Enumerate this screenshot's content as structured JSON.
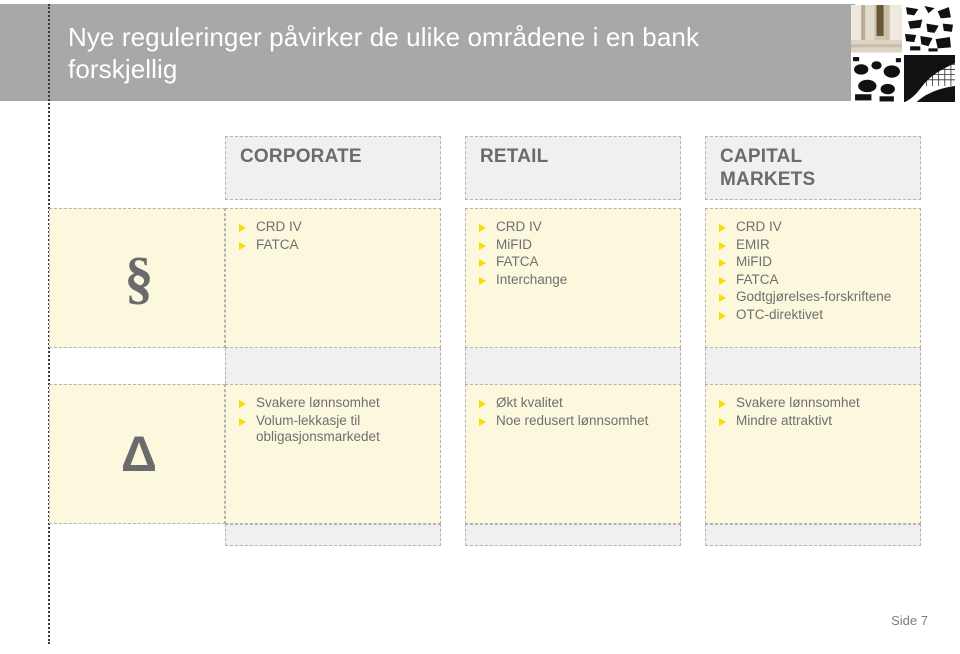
{
  "slide": {
    "title": "Nye reguleringer påvirker de ulike områdene i en bank\nforskjellig",
    "page_label": "Side 7",
    "colors": {
      "header_band": "#a8a8a8",
      "header_text": "#ffffff",
      "cell_cream": "#fbf8dd",
      "cell_grey": "#eef0f1",
      "text_grey": "#6f6f6f",
      "bullet_yellow": "#f4e000",
      "grid_dash": "#b3b3b3"
    }
  },
  "columns": [
    {
      "id": "corporate",
      "title": "CORPORATE"
    },
    {
      "id": "retail",
      "title": "RETAIL"
    },
    {
      "id": "capital_markets",
      "title": "CAPITAL\nMARKETS"
    }
  ],
  "rows": [
    {
      "id": "regulations",
      "glyph": "§",
      "glyph_name": "paragraph-symbol",
      "cells": [
        {
          "column": "corporate",
          "items": [
            "CRD IV",
            "FATCA"
          ]
        },
        {
          "column": "retail",
          "items": [
            "CRD IV",
            "MiFID",
            "FATCA",
            "Interchange"
          ]
        },
        {
          "column": "capital_markets",
          "items": [
            "CRD IV",
            "EMIR",
            "MiFID",
            "FATCA",
            "Godtgjørelses-forskriftene",
            "OTC-direktivet"
          ]
        }
      ]
    },
    {
      "id": "effects",
      "glyph": "Δ",
      "glyph_name": "delta-symbol",
      "cells": [
        {
          "column": "corporate",
          "items": [
            "Svakere lønnsomhet",
            "Volum-lekkasje til obligasjonsmarkedet"
          ]
        },
        {
          "column": "retail",
          "items": [
            "Økt kvalitet",
            "Noe redusert lønnsomhet"
          ]
        },
        {
          "column": "capital_markets",
          "items": [
            "Svakere lønnsomhet",
            "Mindre attraktivt"
          ]
        }
      ]
    },
    {
      "id": "empty",
      "glyph": "",
      "glyph_name": "empty-symbol",
      "cells": [
        {
          "column": "corporate",
          "items": []
        },
        {
          "column": "retail",
          "items": []
        },
        {
          "column": "capital_markets",
          "items": []
        }
      ]
    }
  ]
}
